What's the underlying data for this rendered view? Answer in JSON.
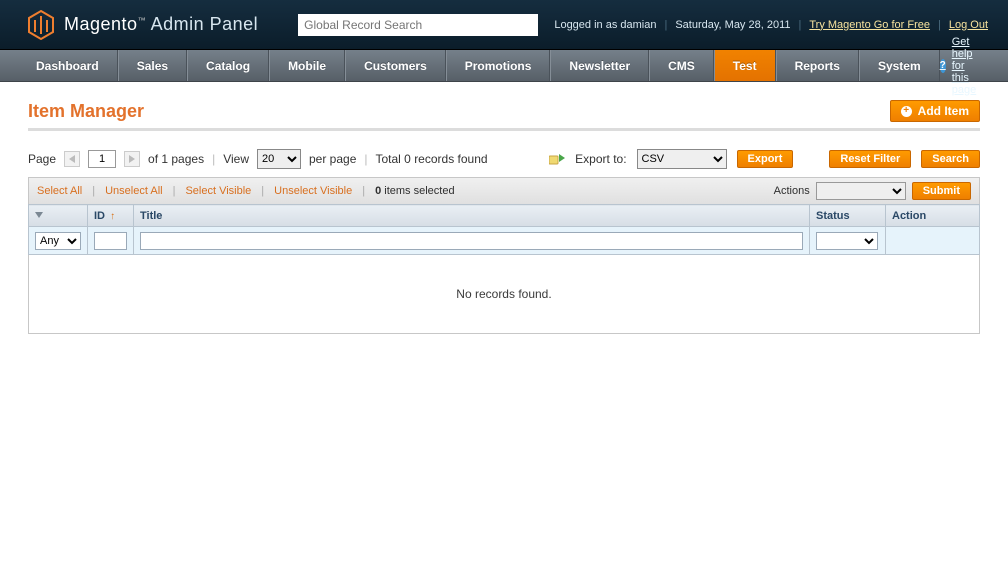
{
  "header": {
    "brand_main": "Magento",
    "brand_sub": "Admin Panel",
    "tm": "™",
    "search_placeholder": "Global Record Search",
    "logged_in_prefix": "Logged in as",
    "logged_in_user": "damian",
    "date": "Saturday, May 28, 2011",
    "try_link": "Try Magento Go for Free",
    "logout": "Log Out"
  },
  "nav": {
    "items": [
      "Dashboard",
      "Sales",
      "Catalog",
      "Mobile",
      "Customers",
      "Promotions",
      "Newsletter",
      "CMS",
      "Test",
      "Reports",
      "System"
    ],
    "active_index": 8,
    "help_text": "Get help for this page"
  },
  "page": {
    "title": "Item Manager",
    "add_button": "Add Item"
  },
  "toolbar": {
    "page_label": "Page",
    "page_value": "1",
    "of_pages": "of 1 pages",
    "view_label": "View",
    "per_page_value": "20",
    "per_page_label": "per page",
    "total_records": "Total 0 records found",
    "export_to": "Export to:",
    "export_format": "CSV",
    "export_button": "Export",
    "reset_filter": "Reset Filter",
    "search": "Search"
  },
  "massaction": {
    "select_all": "Select All",
    "unselect_all": "Unselect All",
    "select_visible": "Select Visible",
    "unselect_visible": "Unselect Visible",
    "items_selected_count": "0",
    "items_selected_label": "items selected",
    "actions_label": "Actions",
    "submit": "Submit"
  },
  "grid": {
    "columns": {
      "id": "ID",
      "title": "Title",
      "status": "Status",
      "action": "Action"
    },
    "filter_any": "Any",
    "no_records": "No records found."
  }
}
